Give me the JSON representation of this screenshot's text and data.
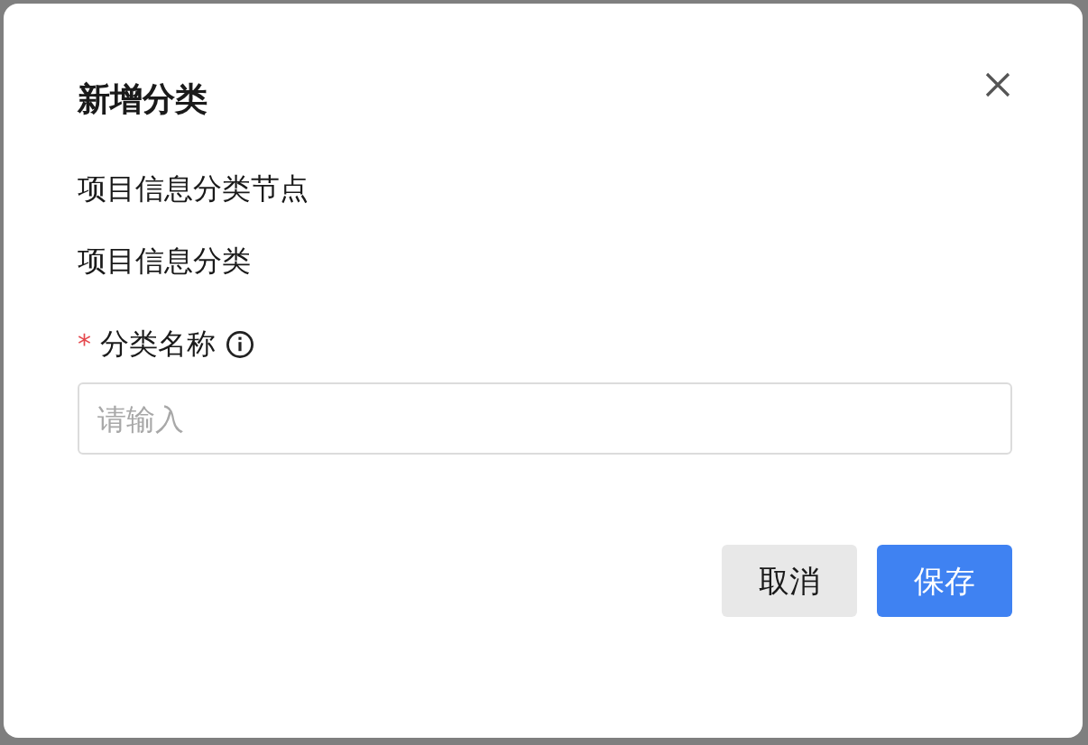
{
  "dialog": {
    "title": "新增分类",
    "info_lines": [
      "项目信息分类节点",
      "项目信息分类"
    ],
    "field": {
      "required_mark": "*",
      "label": "分类名称",
      "placeholder": "请输入"
    },
    "buttons": [
      {
        "label": "取消",
        "kind": "secondary"
      },
      {
        "label": "保存",
        "kind": "primary"
      }
    ]
  }
}
